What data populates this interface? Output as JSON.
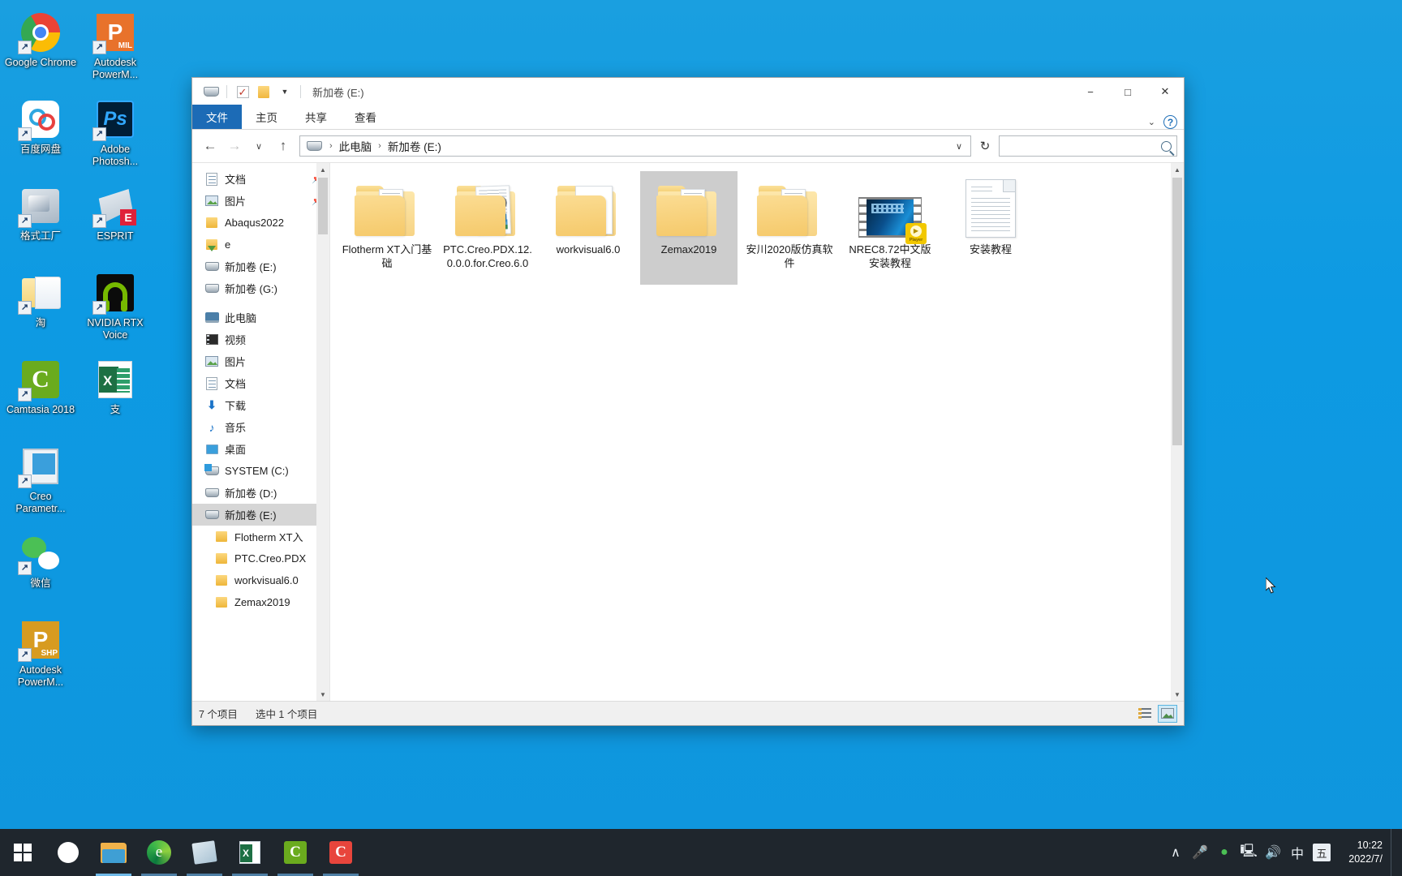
{
  "desktop": {
    "icons": [
      {
        "label": "Google Chrome",
        "icon": "chrome-icon",
        "shortcut": true
      },
      {
        "label": "Autodesk PowerM...",
        "icon": "autodesk-powermill-icon",
        "badge": "MIL",
        "shortcut": true
      },
      {
        "label": "百度网盘",
        "icon": "baidu-netdisk-icon",
        "shortcut": true
      },
      {
        "label": "Adobe Photosh...",
        "icon": "adobe-photoshop-icon",
        "shortcut": true
      },
      {
        "label": "格式工厂",
        "icon": "format-factory-icon",
        "shortcut": true
      },
      {
        "label": "ESPRIT",
        "icon": "esprit-icon",
        "badge": "E",
        "shortcut": true
      },
      {
        "label": "淘",
        "icon": "taobao-folder-icon",
        "shortcut": true
      },
      {
        "label": "NVIDIA RTX Voice",
        "icon": "nvidia-rtx-voice-icon",
        "shortcut": true
      },
      {
        "label": "Camtasia 2018",
        "icon": "camtasia-icon",
        "shortcut": true
      },
      {
        "label": "支",
        "icon": "excel-file-icon",
        "shortcut": false
      },
      {
        "label": "Creo Parametr...",
        "icon": "creo-parametric-icon",
        "shortcut": true
      },
      {
        "label": "微信",
        "icon": "wechat-icon",
        "shortcut": true
      },
      {
        "label": "Autodesk PowerM...",
        "icon": "autodesk-powershape-icon",
        "badge": "SHP",
        "shortcut": true
      }
    ]
  },
  "window": {
    "title": "新加卷 (E:)",
    "quick_access": {
      "properties_icon": "drive-icon",
      "checkbox_icon": "checked-box-icon",
      "folder_icon": "folder-icon",
      "dropdown_icon": "chevron-down-icon"
    },
    "controls": {
      "minimize": "−",
      "maximize": "□",
      "close": "✕"
    }
  },
  "ribbon": {
    "tabs": [
      {
        "label": "文件",
        "active": true
      },
      {
        "label": "主页",
        "active": false
      },
      {
        "label": "共享",
        "active": false
      },
      {
        "label": "查看",
        "active": false
      }
    ],
    "expand_icon": "chevron-down-icon",
    "help_label": "?"
  },
  "navbar": {
    "back_icon": "←",
    "forward_icon": "→",
    "recent_icon": "∨",
    "up_icon": "↑",
    "breadcrumb": [
      "此电脑",
      "新加卷 (E:)"
    ],
    "separator": "›",
    "dropdown_icon": "∨",
    "refresh_icon": "↻",
    "search_placeholder": "",
    "search_value": ""
  },
  "navpane": {
    "items": [
      {
        "label": "文档",
        "icon": "document-icon",
        "indent": 0,
        "pinned": true,
        "selected": false
      },
      {
        "label": "图片",
        "icon": "pictures-icon",
        "indent": 0,
        "pinned": true,
        "selected": false
      },
      {
        "label": "Abaqus2022",
        "icon": "folder-icon",
        "indent": 0,
        "pinned": false,
        "selected": false
      },
      {
        "label": "e",
        "icon": "folder-download-icon",
        "indent": 0,
        "pinned": false,
        "selected": false
      },
      {
        "label": "新加卷 (E:)",
        "icon": "drive-icon",
        "indent": 0,
        "pinned": false,
        "selected": false
      },
      {
        "label": "新加卷 (G:)",
        "icon": "drive-icon",
        "indent": 0,
        "pinned": false,
        "selected": false
      },
      {
        "label": "此电脑",
        "icon": "this-pc-icon",
        "indent": 0,
        "pinned": false,
        "selected": false,
        "gap_before": true
      },
      {
        "label": "视频",
        "icon": "videos-icon",
        "indent": 0,
        "pinned": false,
        "selected": false
      },
      {
        "label": "图片",
        "icon": "pictures-icon",
        "indent": 0,
        "pinned": false,
        "selected": false
      },
      {
        "label": "文档",
        "icon": "document-icon",
        "indent": 0,
        "pinned": false,
        "selected": false
      },
      {
        "label": "下载",
        "icon": "downloads-icon",
        "indent": 0,
        "pinned": false,
        "selected": false
      },
      {
        "label": "音乐",
        "icon": "music-icon",
        "indent": 0,
        "pinned": false,
        "selected": false
      },
      {
        "label": "桌面",
        "icon": "desktop-icon",
        "indent": 0,
        "pinned": false,
        "selected": false
      },
      {
        "label": "SYSTEM (C:)",
        "icon": "system-drive-icon",
        "indent": 0,
        "pinned": false,
        "selected": false
      },
      {
        "label": "新加卷 (D:)",
        "icon": "drive-icon",
        "indent": 0,
        "pinned": false,
        "selected": false
      },
      {
        "label": "新加卷 (E:)",
        "icon": "drive-icon",
        "indent": 0,
        "pinned": false,
        "selected": true
      },
      {
        "label": "Flotherm XT入",
        "icon": "folder-icon",
        "indent": 1,
        "pinned": false,
        "selected": false
      },
      {
        "label": "PTC.Creo.PDX",
        "icon": "folder-icon",
        "indent": 1,
        "pinned": false,
        "selected": false
      },
      {
        "label": "workvisual6.0",
        "icon": "folder-icon",
        "indent": 1,
        "pinned": false,
        "selected": false
      },
      {
        "label": "Zemax2019",
        "icon": "folder-icon",
        "indent": 1,
        "pinned": false,
        "selected": false
      }
    ],
    "pin_glyph": "📌"
  },
  "files": [
    {
      "name": "Flotherm XT入门基础",
      "type": "folder",
      "selected": false
    },
    {
      "name": "PTC.Creo.PDX.12.0.0.0.for.Creo.6.0",
      "type": "folder-creo",
      "selected": false
    },
    {
      "name": "workvisual6.0",
      "type": "folder-image",
      "selected": false
    },
    {
      "name": "Zemax2019",
      "type": "folder",
      "selected": true
    },
    {
      "name": "安川2020版仿真软件",
      "type": "folder",
      "selected": false
    },
    {
      "name": "NREC8.72中文版安装教程",
      "type": "video",
      "selected": false,
      "badge": "Player"
    },
    {
      "name": "安装教程",
      "type": "document",
      "selected": false
    }
  ],
  "statusbar": {
    "item_count": "7 个项目",
    "selection": "选中 1 个项目",
    "view_details_label": "details-view",
    "view_icons_label": "large-icons-view"
  },
  "taskbar": {
    "start_label": "start",
    "items": [
      {
        "name": "search",
        "icon": "search-icon"
      },
      {
        "name": "file-explorer",
        "icon": "folder-icon",
        "state": "active"
      },
      {
        "name": "microsoft-edge",
        "icon": "edge-icon",
        "state": "running"
      },
      {
        "name": "sticky-notes",
        "icon": "note-icon",
        "state": "running"
      },
      {
        "name": "excel",
        "icon": "excel-icon",
        "state": "running"
      },
      {
        "name": "camtasia-studio",
        "icon": "camtasia-icon",
        "state": "running"
      },
      {
        "name": "camtasia-recorder",
        "icon": "camtasia-recorder-icon",
        "state": "running"
      }
    ],
    "tray": [
      {
        "name": "show-hidden-icons",
        "glyph": "∧"
      },
      {
        "name": "microphone",
        "glyph": "🎙"
      },
      {
        "name": "wechat",
        "glyph": "●"
      },
      {
        "name": "network",
        "glyph": "⬚"
      },
      {
        "name": "volume",
        "glyph": "🔊"
      },
      {
        "name": "ime-chinese",
        "glyph": "中"
      },
      {
        "name": "ime-mode",
        "glyph": "五"
      }
    ],
    "clock_time": "10:22",
    "clock_date": "2022/7/"
  }
}
